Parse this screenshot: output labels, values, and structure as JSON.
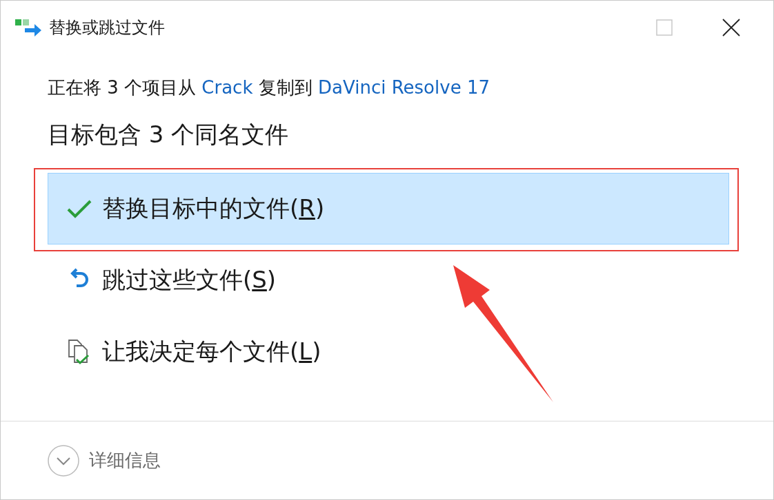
{
  "window": {
    "title": "替换或跳过文件",
    "controls": [
      {
        "kind": "maximize",
        "disabled": true
      },
      {
        "kind": "close",
        "disabled": false
      }
    ]
  },
  "message": [
    {
      "kind": "text",
      "text": "正在将 3 个项目从 "
    },
    {
      "kind": "link",
      "text": "Crack"
    },
    {
      "kind": "text",
      "text": " 复制到 "
    },
    {
      "kind": "link",
      "text": "DaVinci Resolve 17"
    }
  ],
  "heading": "目标包含 3 个同名文件",
  "options": [
    {
      "kind": "replace",
      "before": "替换目标中的文件(",
      "access_key": "R",
      "after": ")",
      "selected": true,
      "highlighted": true
    },
    {
      "kind": "skip",
      "before": "跳过这些文件(",
      "access_key": "S",
      "after": ")",
      "selected": false
    },
    {
      "kind": "decide",
      "before": "让我决定每个文件(",
      "access_key": "L",
      "after": ")",
      "selected": false
    }
  ],
  "details": {
    "label": "详细信息",
    "expanded": false
  }
}
